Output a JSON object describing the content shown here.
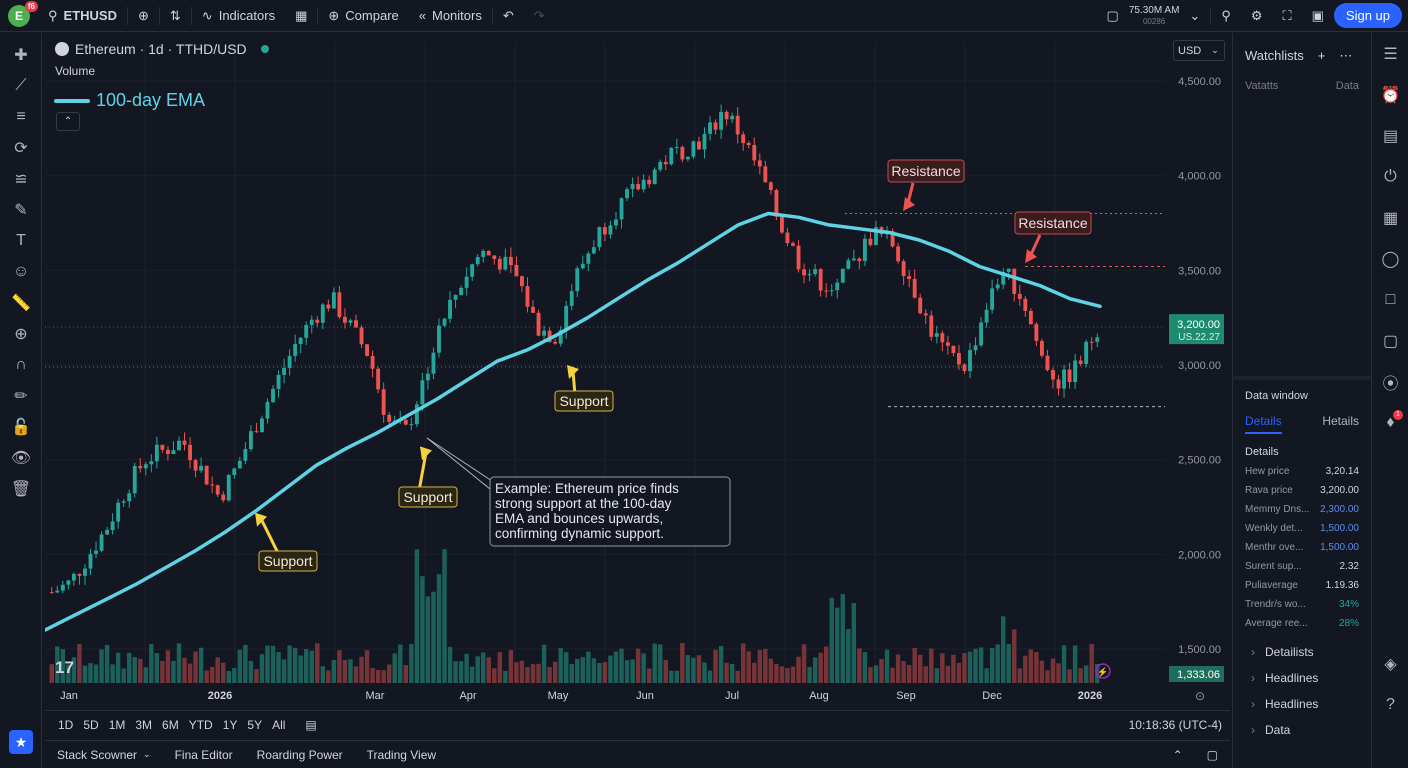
{
  "topbar": {
    "logo_badge": "f6",
    "symbol": "ETHUSD",
    "indicators": "Indicators",
    "compare": "Compare",
    "monitors": "Monitors",
    "clock_time": "75.30M AM",
    "clock_sub": "00286",
    "signup": "Sign up"
  },
  "legend": {
    "title": "Ethereum · 1d · TTHD/USD",
    "volume": "Volume",
    "ema_label": "100-day EMA",
    "currency": "USD"
  },
  "chart_data": {
    "type": "candlestick",
    "x_labels": [
      "Jan",
      "2026",
      "Mar",
      "Apr",
      "May",
      "Jun",
      "Jul",
      "Aug",
      "Sep",
      "Dec",
      "2026"
    ],
    "y_ticks": [
      "4,500.00",
      "4,000.00",
      "3,500.00",
      "3,200.00",
      "3,000.00",
      "2,500.00",
      "2,000.00",
      "1,500.00"
    ],
    "ylim": [
      1300,
      4550
    ],
    "price_label": "3,200.00",
    "price_sub": "US.22.27",
    "volume_label": "1,333.06",
    "price_path": [
      1800,
      1850,
      2000,
      2150,
      2350,
      2500,
      2550,
      2600,
      2450,
      2300,
      2480,
      2700,
      2900,
      3100,
      3250,
      3350,
      3200,
      3050,
      2700,
      2650,
      2950,
      3250,
      3450,
      3600,
      3550,
      3450,
      3200,
      3150,
      3450,
      3650,
      3800,
      3900,
      4000,
      4100,
      4150,
      4200,
      4350,
      4200,
      4000,
      3750,
      3550,
      3450,
      3400,
      3550,
      3700,
      3650,
      3450,
      3200,
      3050,
      3000,
      3300,
      3500,
      3350,
      3050,
      2900,
      3000,
      3200
    ],
    "ema_path": [
      1600,
      1680,
      1760,
      1840,
      1930,
      2020,
      2120,
      2230,
      2350,
      2470,
      2560,
      2640,
      2730,
      2820,
      2920,
      3020,
      3080,
      3160,
      3250,
      3350,
      3450,
      3540,
      3640,
      3740,
      3800,
      3780,
      3740,
      3720,
      3700,
      3660,
      3600,
      3520,
      3470,
      3420,
      3350,
      3310
    ],
    "series": [
      {
        "name": "100-day EMA",
        "color": "#5fd3e6"
      }
    ],
    "resistance_levels": [
      3800,
      3520
    ],
    "support_level": 2780,
    "annotations": [
      {
        "label": "Support",
        "type": "support"
      },
      {
        "label": "Support",
        "type": "support"
      },
      {
        "label": "Support",
        "type": "support"
      },
      {
        "label": "Resistance",
        "type": "resistance"
      },
      {
        "label": "Resistance",
        "type": "resistance"
      }
    ],
    "callout": "Example: Ethereum price finds strong support at the 100-day EMA and bounces upwards, confirming dynamic support."
  },
  "timebar": {
    "ranges": [
      "1D",
      "5D",
      "1M",
      "3M",
      "6M",
      "YTD",
      "1Y",
      "5Y",
      "All"
    ],
    "time": "10:18:36 (UTC-4)"
  },
  "bottombar": {
    "tabs": [
      "Stack Scowner",
      "Fina Editor",
      "Roarding Power",
      "Trading View"
    ]
  },
  "watchlist": {
    "title": "Watchlists",
    "col1": "Vatatts",
    "col2": "Data"
  },
  "datawindow": {
    "title": "Data window",
    "tab1": "Details",
    "tab2": "Hetails",
    "section": "Details",
    "rows": [
      {
        "k": "Hew price",
        "v": "3,20.14",
        "c": "#d1d4dc"
      },
      {
        "k": "Rava price",
        "v": "3,200.00",
        "c": "#d1d4dc"
      },
      {
        "k": "Memmy Dns...",
        "v": "2,300.00",
        "c": "#5b8def"
      },
      {
        "k": "Wenkly det...",
        "v": "1,500.00",
        "c": "#5b8def"
      },
      {
        "k": "Menthr ove...",
        "v": "1,500.00",
        "c": "#5b8def"
      },
      {
        "k": "Surent sup...",
        "v": "2.32",
        "c": "#d1d4dc"
      },
      {
        "k": "Puliaverage",
        "v": "1.19.36",
        "c": "#d1d4dc"
      },
      {
        "k": "Trendr/s wo...",
        "v": "34%",
        "c": "#26a69a"
      },
      {
        "k": "Average ree...",
        "v": "28%",
        "c": "#26a69a"
      }
    ],
    "groups": [
      "Detailists",
      "Headlines",
      "Headlines",
      "Data"
    ]
  },
  "colors": {
    "up": "#26a69a",
    "down": "#ef5350",
    "ema": "#5fd3e6",
    "accent": "#2962ff"
  }
}
